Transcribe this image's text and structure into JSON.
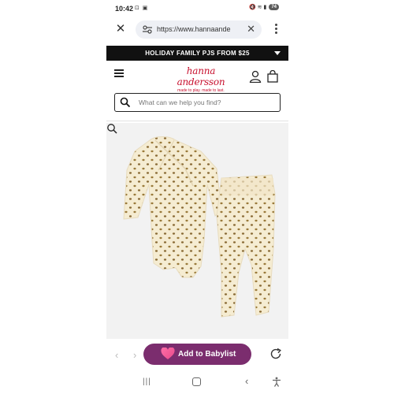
{
  "status_bar": {
    "time": "10:42",
    "left_icons": "⊡ ▣",
    "right_icons": "🔇 ≋ ▮",
    "battery": "74"
  },
  "browser": {
    "url": "https://www.hannaande",
    "icons": [
      "close-icon",
      "tune-icon",
      "clear-icon",
      "more-vert-icon"
    ]
  },
  "promo": {
    "text": "HOLIDAY FAMILY PJS FROM $25"
  },
  "header": {
    "brand": "hanna andersson",
    "tagline": "made to play. made to last."
  },
  "search": {
    "placeholder": "What can we help you find?"
  },
  "product": {
    "image_alt": "Baby wrap bodysuit and pants set, cream with gold dot print",
    "colors": {
      "fabric": "#f5ecd2",
      "dots": "#9a7a3a",
      "background": "#f2f2f2"
    }
  },
  "bottom_bar": {
    "add_babylist_label": "Add to Babylist",
    "button_color": "#7b2d6e"
  },
  "colors": {
    "brand_red": "#c8102e",
    "promo_bg": "#111111"
  }
}
